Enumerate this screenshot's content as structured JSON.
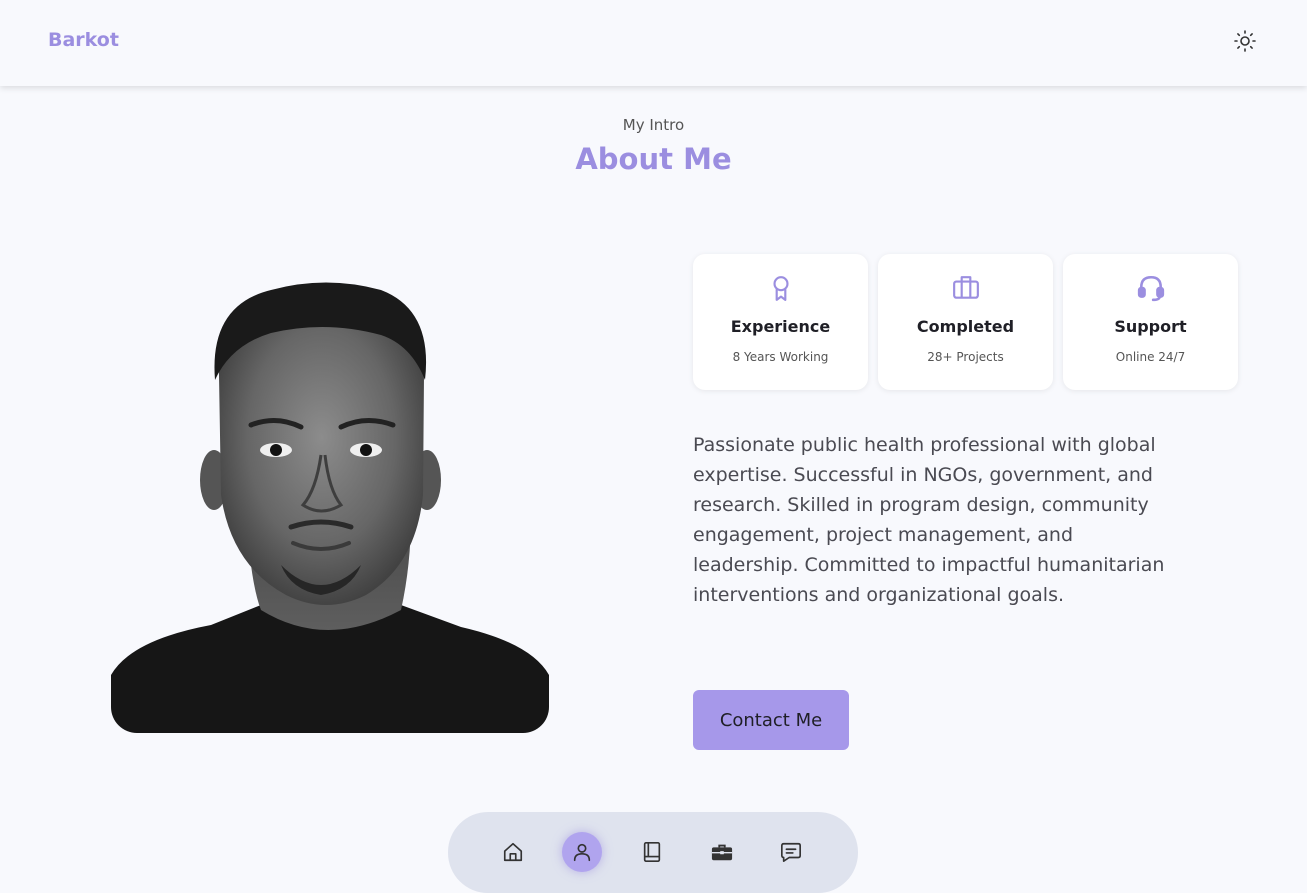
{
  "header": {
    "logo": "Barkot",
    "theme_toggle_icon": "sun-icon"
  },
  "section": {
    "subtitle": "My Intro",
    "title": "About Me"
  },
  "cards": [
    {
      "icon": "award-icon",
      "title": "Experience",
      "subtitle": "8 Years Working"
    },
    {
      "icon": "briefcase-icon",
      "title": "Completed",
      "subtitle": "28+ Projects"
    },
    {
      "icon": "headset-icon",
      "title": "Support",
      "subtitle": "Online 24/7"
    }
  ],
  "description": "Passionate public health professional with global expertise. Successful in NGOs, government, and research. Skilled in program design, community engagement, project management, and leadership. Committed to impactful humanitarian interventions and organizational goals.",
  "contact_button": "Contact Me",
  "bottom_nav": {
    "items": [
      {
        "icon": "home-icon",
        "active": false
      },
      {
        "icon": "user-icon",
        "active": true
      },
      {
        "icon": "book-icon",
        "active": false
      },
      {
        "icon": "briefcase-icon",
        "active": false
      },
      {
        "icon": "message-icon",
        "active": false
      }
    ]
  },
  "colors": {
    "accent": "#9b8ee0",
    "button": "#a698ea",
    "background": "#f8f9fd",
    "nav_background": "#dfe3ee"
  }
}
